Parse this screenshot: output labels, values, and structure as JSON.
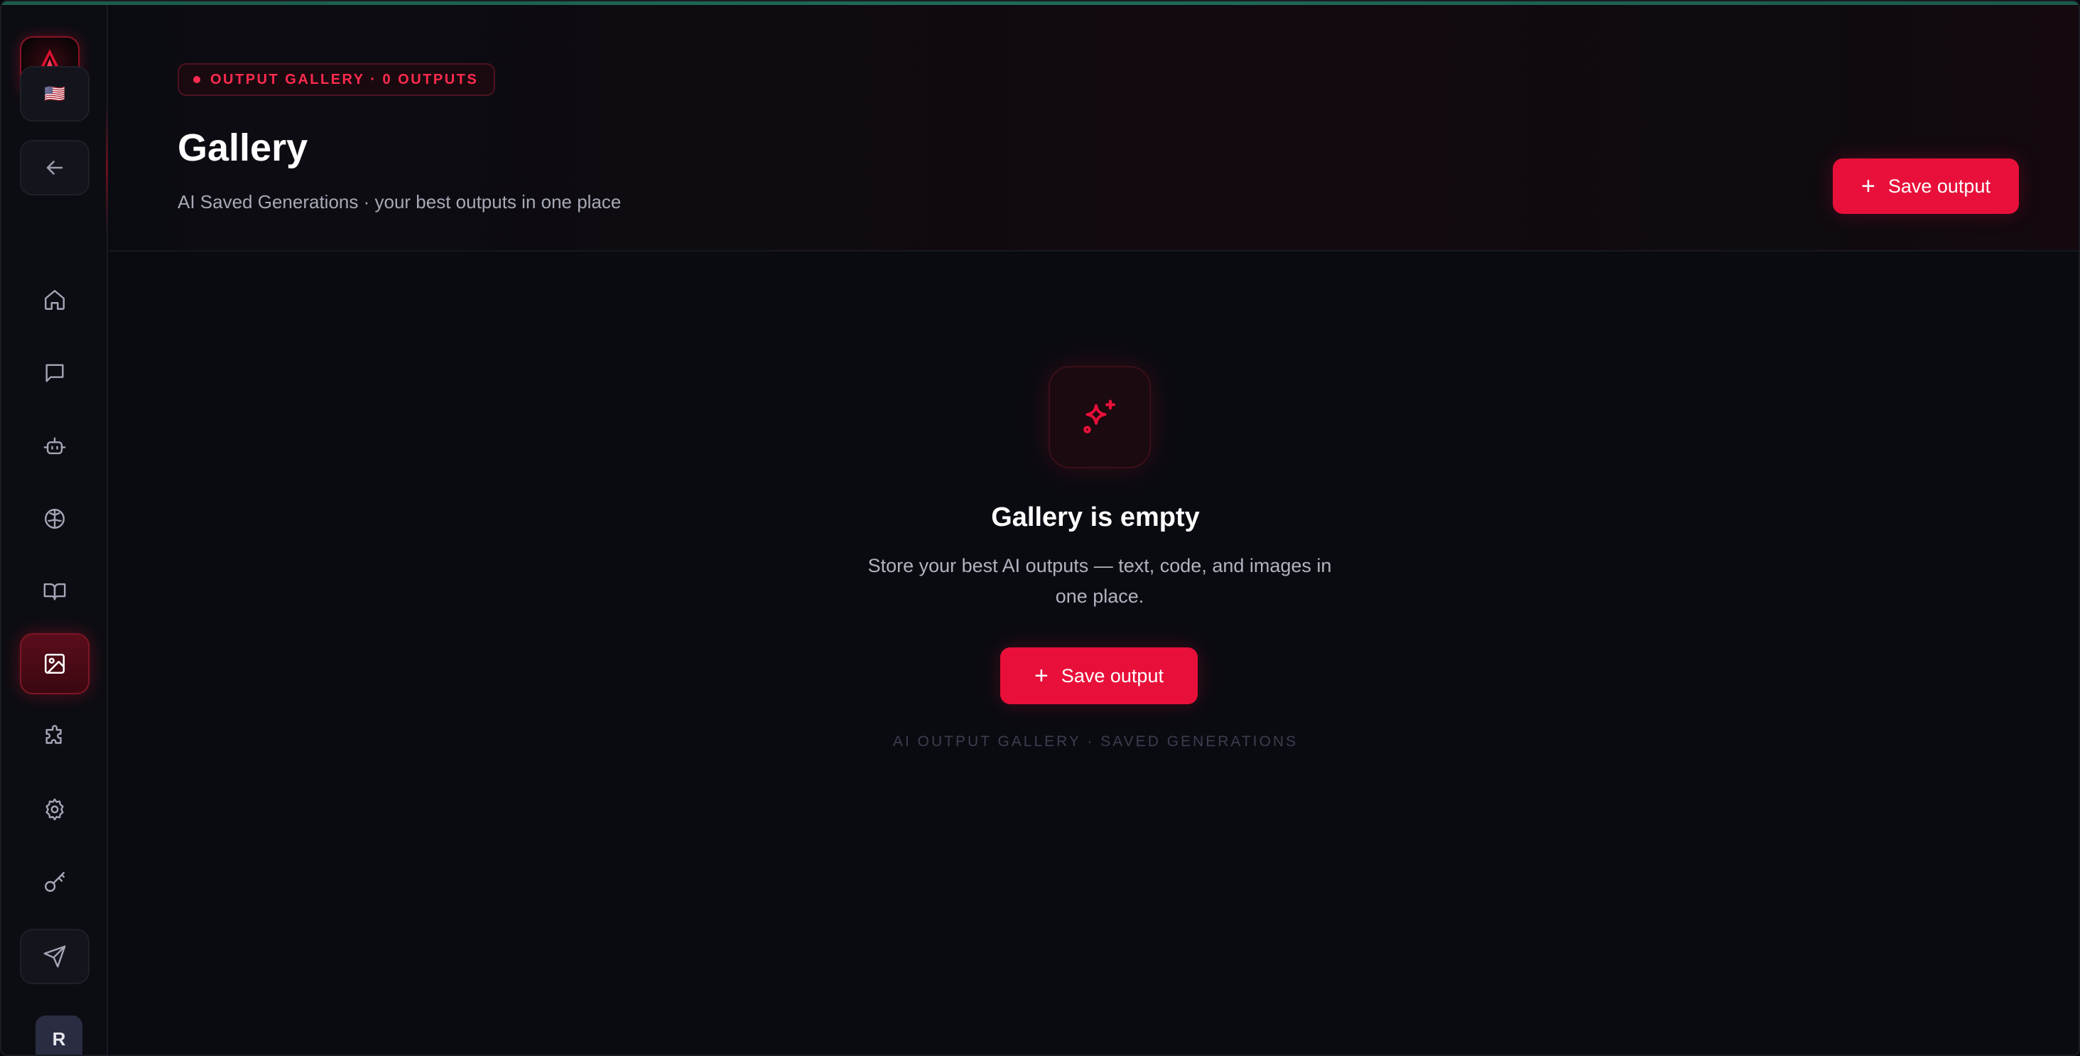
{
  "sidebar": {
    "language_flag": "🇺🇸",
    "items": [
      {
        "name": "home",
        "icon": "home-icon"
      },
      {
        "name": "chat",
        "icon": "chat-icon"
      },
      {
        "name": "agents",
        "icon": "bot-icon"
      },
      {
        "name": "brain",
        "icon": "brain-icon"
      },
      {
        "name": "library",
        "icon": "book-icon"
      },
      {
        "name": "gallery",
        "icon": "image-icon",
        "active": true
      },
      {
        "name": "plugins",
        "icon": "puzzle-icon"
      },
      {
        "name": "settings",
        "icon": "gear-icon"
      },
      {
        "name": "keys",
        "icon": "key-icon"
      },
      {
        "name": "send",
        "icon": "send-icon"
      }
    ],
    "avatar_initial": "R"
  },
  "header": {
    "badge": "OUTPUT GALLERY · 0 OUTPUTS",
    "title": "Gallery",
    "subtitle": "AI Saved Generations · your best outputs in one place",
    "save_button_label": "Save output"
  },
  "empty_state": {
    "icon": "sparkle-icon",
    "title": "Gallery is empty",
    "description": "Store your best AI outputs — text, code, and images in one place.",
    "button_label": "Save output",
    "footer": "AI OUTPUT GALLERY · SAVED GENERATIONS"
  },
  "colors": {
    "accent": "#e8103a",
    "background": "#0a0b11",
    "sidebar": "#0c0d13"
  }
}
